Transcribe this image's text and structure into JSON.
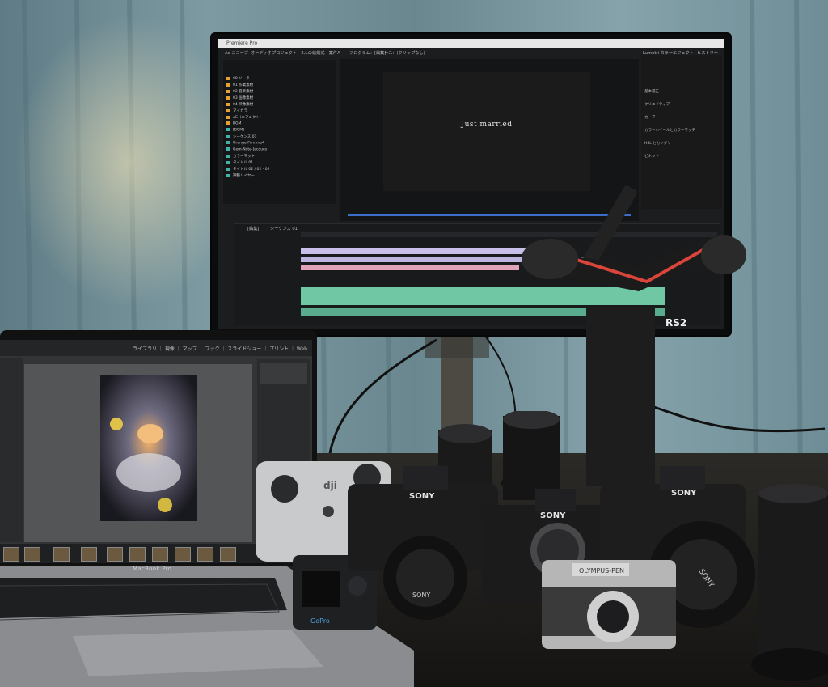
{
  "monitor": {
    "title_bar": "Premiere Pro",
    "top_tabs": [
      "Ae スコープ",
      "オーディオ",
      "プロジェクト：2人の結婚式 - 案件A",
      "プログラム：[編集]",
      "ソース：(クリップなし)",
      "Lumetri カラー",
      "エフェクト",
      "ヒストリー"
    ],
    "project_bins": [
      "00 ソーラー",
      "01 作業素材",
      "02 音楽素材",
      "03 画像素材",
      "04 映像素材",
      "マイカラ",
      "AE（エフェクト）",
      "BGM",
      "[BGM]",
      "シーケンス 01",
      "Orange-Film.mp4",
      "Gem-Note-Jacques",
      "カラーマット",
      "タイトル 01",
      "タイトル 02 / 02 - 02",
      "調整レイヤー"
    ],
    "program_text": "Just married",
    "effects_items": [
      "基本補正",
      "クリエイティブ",
      "カーブ",
      "カラーホイールとカラーマッチ",
      "HSL セカンダリ",
      "ビネット"
    ],
    "timeline_tabs": [
      "[編集]",
      "シーケンス 01"
    ],
    "gimbal_label": "RS2"
  },
  "laptop": {
    "lr_modules": "ライブラリ ｜ 現像 ｜ マップ ｜ ブック ｜ スライドショー ｜ プリント ｜ Web",
    "brand_label": "MacBook Pro"
  },
  "gear": {
    "remote_logo": "dji",
    "gopro_label": "GoPro",
    "sony_labels": [
      "SONY",
      "SONY",
      "SONY",
      "SONY",
      "SONY"
    ],
    "olympus_label": "OLYMPUS-PEN"
  },
  "colors": {
    "curtain": "#6f8e97",
    "timeline_audio": "#6fc7a4",
    "timeline_video": "#c8c0e8",
    "folder": "#e4a233"
  }
}
